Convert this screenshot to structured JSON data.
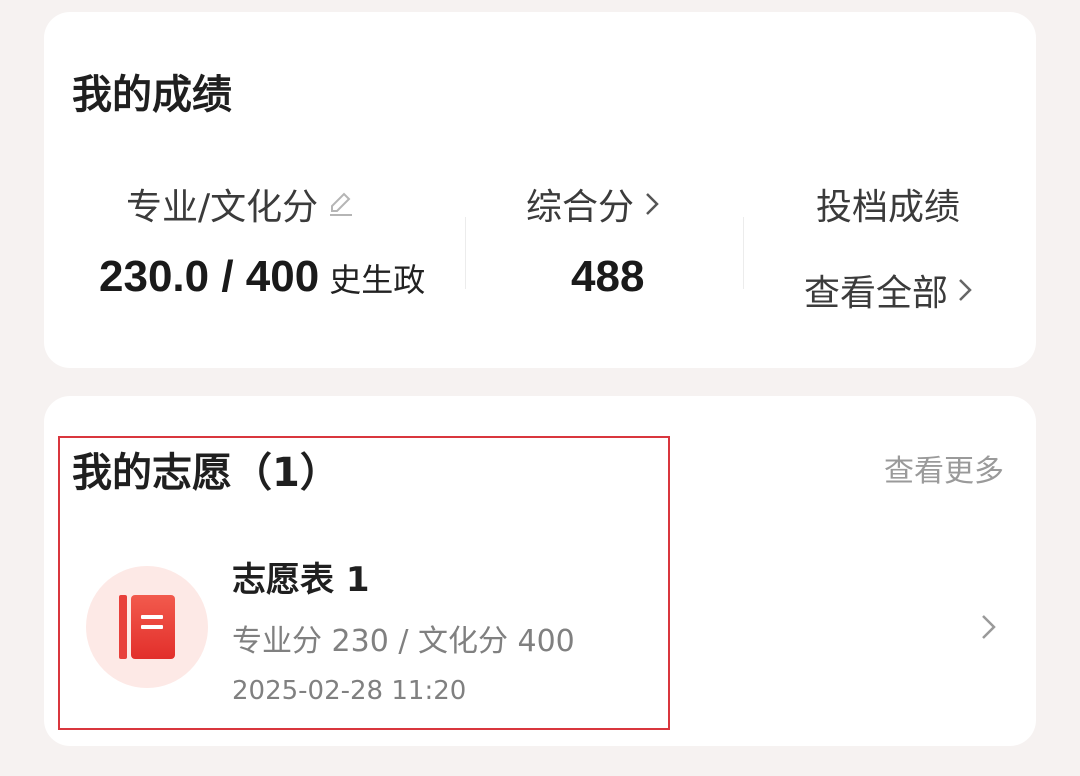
{
  "score_card": {
    "title": "我的成绩",
    "professional_culture": {
      "label": "专业/文化分",
      "value": "230.0 / 400",
      "subjects": "史生政"
    },
    "composite": {
      "label": "综合分",
      "value": "488"
    },
    "admission": {
      "label": "投档成绩",
      "link": "查看全部"
    }
  },
  "wish_card": {
    "title": "我的志愿（1）",
    "more": "查看更多",
    "item": {
      "name": "志愿表 1",
      "scores": "专业分 230 / 文化分 400",
      "time": "2025-02-28 11:20"
    }
  },
  "icons": [
    "edit-icon",
    "chevron-right-icon",
    "book-icon"
  ],
  "colors": {
    "accent": "#e8403b",
    "highlight_border": "#d9363e",
    "icon_bg": "#fde9e6"
  }
}
